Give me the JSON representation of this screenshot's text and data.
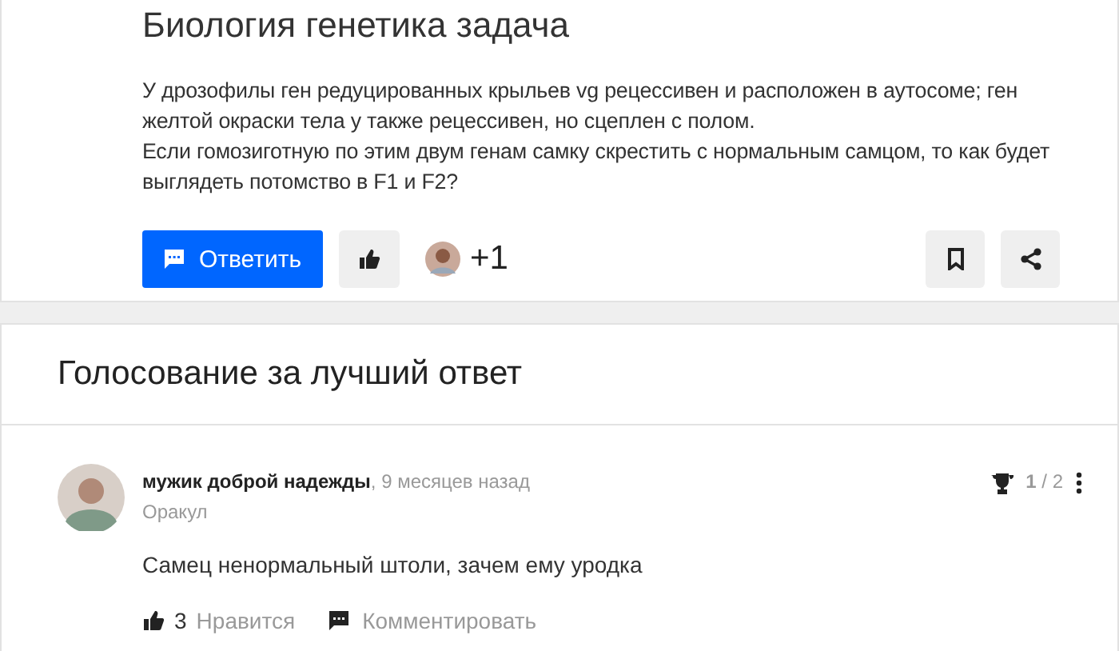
{
  "question": {
    "title": "Биология генетика задача",
    "paragraphs": [
      "У дрозофилы ген редуцированных крыльев vg рецессивен и расположен в аутосоме; ген желтой окраски тела у также рецессивен, но сцеплен с полом.",
      "Если гомозиготную по этим двум генам самку скрестить с нормальным самцом, то как будет выглядеть потомство в F1 и F2?"
    ],
    "answer_button": "Ответить",
    "likers_count": "+1"
  },
  "voting": {
    "title": "Голосование за лучший ответ",
    "answer": {
      "author": "мужик доброй надежды",
      "time": ", 9 месяцев назад",
      "rank": "Оракул",
      "score": "**1** / 2",
      "text": "Самец ненормальный штоли, зачем ему уродка",
      "likes": "3",
      "like_label": "Нравится",
      "comment_label": "Комментировать"
    }
  }
}
